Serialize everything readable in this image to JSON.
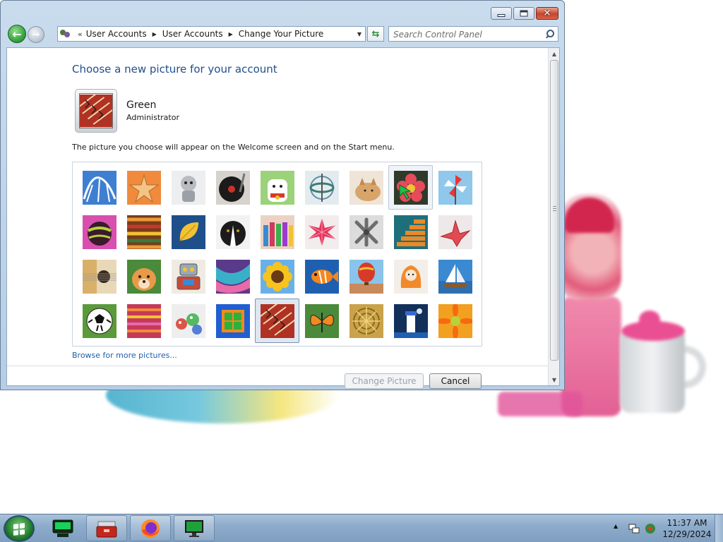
{
  "window": {
    "nav": {
      "overflow": "«",
      "breadcrumbs": [
        "User Accounts",
        "User Accounts",
        "Change Your Picture"
      ]
    },
    "search": {
      "placeholder": "Search Control Panel"
    }
  },
  "page": {
    "title": "Choose a new picture for your account",
    "user": {
      "name": "Green",
      "role": "Administrator"
    },
    "description": "The picture you choose will appear on the Welcome screen and on the Start menu.",
    "pictures": [
      "coaster",
      "starfish",
      "robot-figure",
      "turntable",
      "lucky-cat",
      "gyroscope",
      "kitten",
      "flower",
      "pinwheel",
      "ball",
      "fabric",
      "leaf",
      "dog",
      "crayons",
      "paper-star",
      "jacks",
      "stairs",
      "paper-crane",
      "guitar",
      "puppy",
      "toy-robot",
      "scarf",
      "sunflower",
      "fish",
      "balloon",
      "doll",
      "sailboat",
      "soccer-ball",
      "cloth",
      "marbles",
      "window",
      "pattern-fabric",
      "butterfly",
      "basket",
      "lighthouse",
      "gerbera"
    ],
    "selected_index": 31,
    "hover_index": 7,
    "browse_link": "Browse for more pictures...",
    "buttons": {
      "change": "Change Picture",
      "change_enabled": false,
      "cancel": "Cancel"
    }
  },
  "taskbar": {
    "apps": [
      "terminal-app",
      "toolbox-app",
      "firefox-app",
      "monitor-app"
    ],
    "clock": {
      "time": "11:37 AM",
      "date": "12/29/2024"
    }
  },
  "colors": {
    "link": "#1f5fa8",
    "title": "#1f4e8c",
    "taskbar": "#8eaccb"
  }
}
